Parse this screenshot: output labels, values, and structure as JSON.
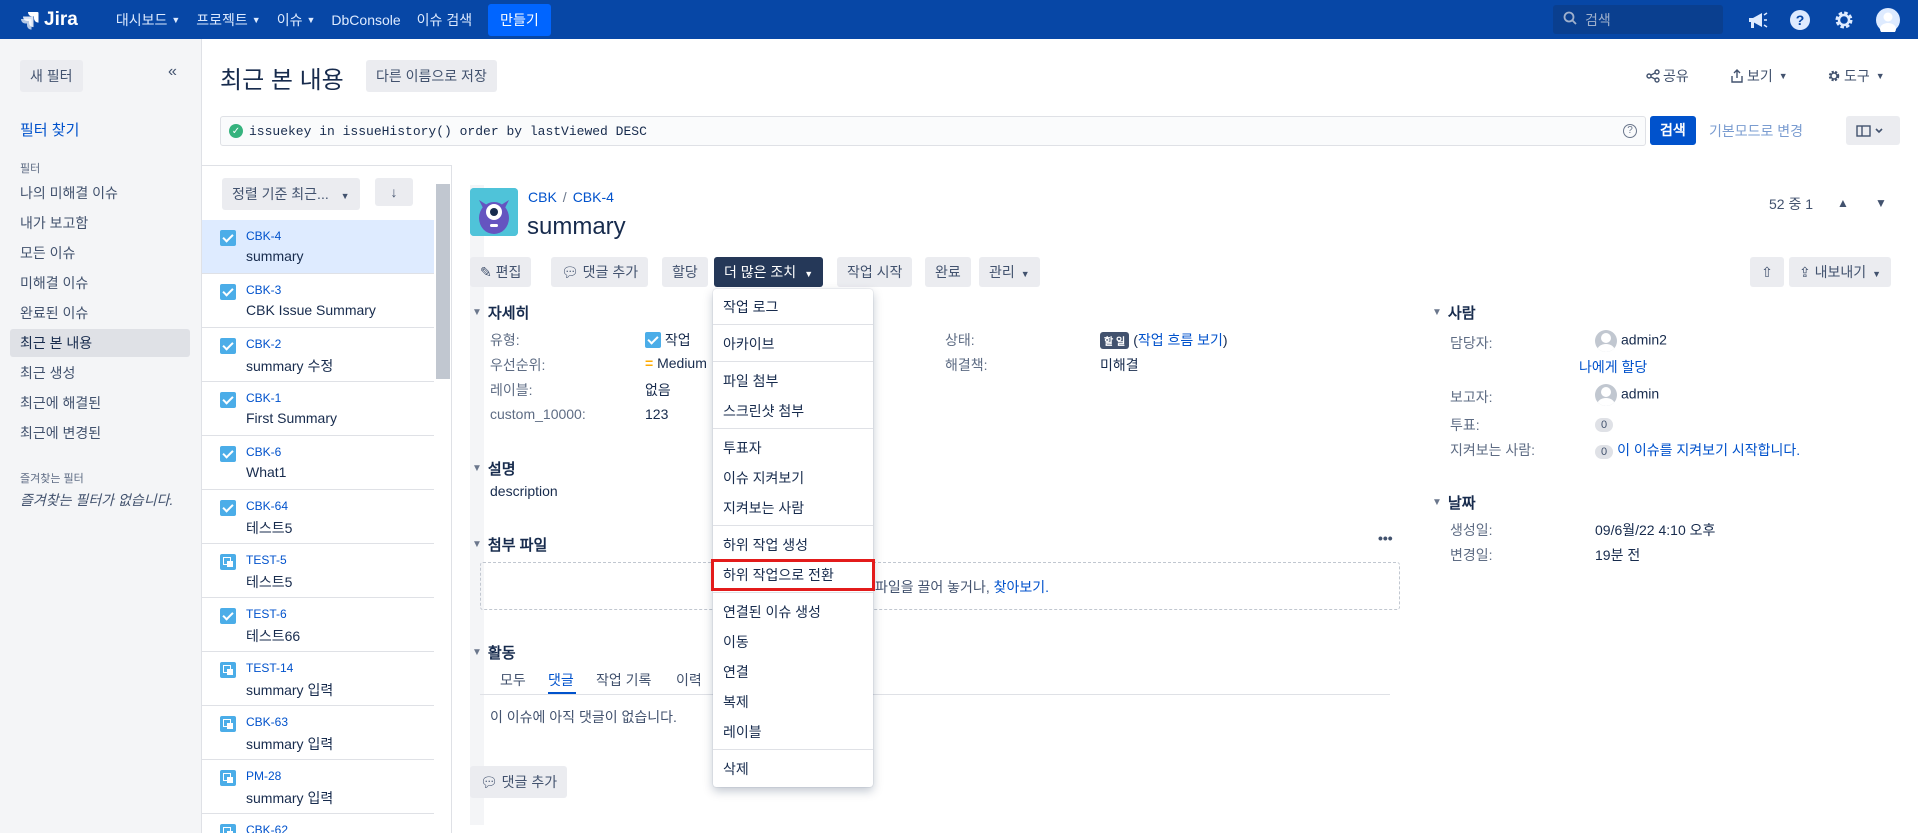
{
  "topnav": {
    "logo": "Jira",
    "items": [
      "대시보드",
      "프로젝트",
      "이슈",
      "DbConsole",
      "이슈 검색"
    ],
    "create": "만들기",
    "search_placeholder": "검색"
  },
  "sidebar": {
    "new_filter": "새 필터",
    "find_filters": "필터 찾기",
    "filters_heading": "필터",
    "items": [
      "나의 미해결 이슈",
      "내가 보고함",
      "모든 이슈",
      "미해결 이슈",
      "완료된 이슈",
      "최근 본 내용",
      "최근 생성",
      "최근에 해결된",
      "최근에 변경된"
    ],
    "active_index": 5,
    "favorites_heading": "즐겨찾는 필터",
    "no_favorites": "즐겨찾는 필터가 없습니다."
  },
  "header": {
    "title": "최근 본 내용",
    "save_as": "다른 이름으로 저장",
    "share": "공유",
    "view": "보기",
    "tools": "도구",
    "jql": "issuekey in issueHistory() order by lastViewed DESC",
    "search_btn": "검색",
    "basic_mode": "기본모드로 변경"
  },
  "list": {
    "sort_label": "정렬 기준 최근...",
    "rows": [
      {
        "key": "CBK-4",
        "summary": "summary",
        "type": "task"
      },
      {
        "key": "CBK-3",
        "summary": "CBK Issue Summary",
        "type": "task"
      },
      {
        "key": "CBK-2",
        "summary": "summary 수정",
        "type": "task"
      },
      {
        "key": "CBK-1",
        "summary": "First Summary",
        "type": "task"
      },
      {
        "key": "CBK-6",
        "summary": "What1",
        "type": "task"
      },
      {
        "key": "CBK-64",
        "summary": "테스트5",
        "type": "task"
      },
      {
        "key": "TEST-5",
        "summary": "테스트5",
        "type": "subtask"
      },
      {
        "key": "TEST-6",
        "summary": "테스트66",
        "type": "task"
      },
      {
        "key": "TEST-14",
        "summary": "summary 입력",
        "type": "subtask"
      },
      {
        "key": "CBK-63",
        "summary": "summary 입력",
        "type": "subtask"
      },
      {
        "key": "PM-28",
        "summary": "summary 입력",
        "type": "subtask"
      },
      {
        "key": "CBK-62",
        "summary": "",
        "type": "subtask"
      }
    ]
  },
  "issue": {
    "project": "CBK",
    "key": "CBK-4",
    "summary": "summary",
    "counter": "52 중 1",
    "ops": {
      "edit": "편집",
      "comment": "댓글 추가",
      "assign": "할당",
      "more": "더 많은 조치",
      "start": "작업 시작",
      "done": "완료",
      "admin": "관리",
      "export": "내보내기"
    },
    "details": {
      "heading": "자세히",
      "type_label": "유형:",
      "type_value": "작업",
      "priority_label": "우선순위:",
      "priority_value": "Medium",
      "labels_label": "레이블:",
      "labels_value": "없음",
      "custom_label": "custom_10000:",
      "custom_value": "123",
      "status_label": "상태:",
      "status_badge": "할 일",
      "workflow_link": "작업 흐름 보기",
      "resolution_label": "해결책:",
      "resolution_value": "미해결"
    },
    "description": {
      "heading": "설명",
      "text": "description"
    },
    "attachments": {
      "heading": "첨부 파일",
      "drop_text": "파일을 끌어 놓거나,",
      "browse": "찾아보기."
    },
    "activity": {
      "heading": "활동",
      "tabs": [
        "모두",
        "댓글",
        "작업 기록",
        "이력"
      ],
      "empty": "이 이슈에 아직 댓글이 없습니다.",
      "add_comment": "댓글 추가"
    },
    "people": {
      "heading": "사람",
      "assignee_label": "담당자:",
      "assignee": "admin2",
      "assign_me": "나에게 할당",
      "reporter_label": "보고자:",
      "reporter": "admin",
      "votes_label": "투표:",
      "votes": "0",
      "watchers_label": "지켜보는 사람:",
      "watchers": "0",
      "watch_link": "이 이슈를 지켜보기 시작합니다."
    },
    "dates": {
      "heading": "날짜",
      "created_label": "생성일:",
      "created": "09/6월/22 4:10 오후",
      "updated_label": "변경일:",
      "updated": "19분 전"
    }
  },
  "more_menu": {
    "items": [
      "작업 로그",
      "아카이브",
      "파일 첨부",
      "스크린샷 첨부",
      "투표자",
      "이슈 지켜보기",
      "지켜보는 사람",
      "하위 작업 생성",
      "하위 작업으로 전환",
      "연결된 이슈 생성",
      "이동",
      "연결",
      "복제",
      "레이블",
      "삭제"
    ],
    "highlighted": "하위 작업으로 전환"
  },
  "colors": {
    "nav": "#0747a6",
    "accent": "#0052cc",
    "highlight": "#e31b1b"
  }
}
